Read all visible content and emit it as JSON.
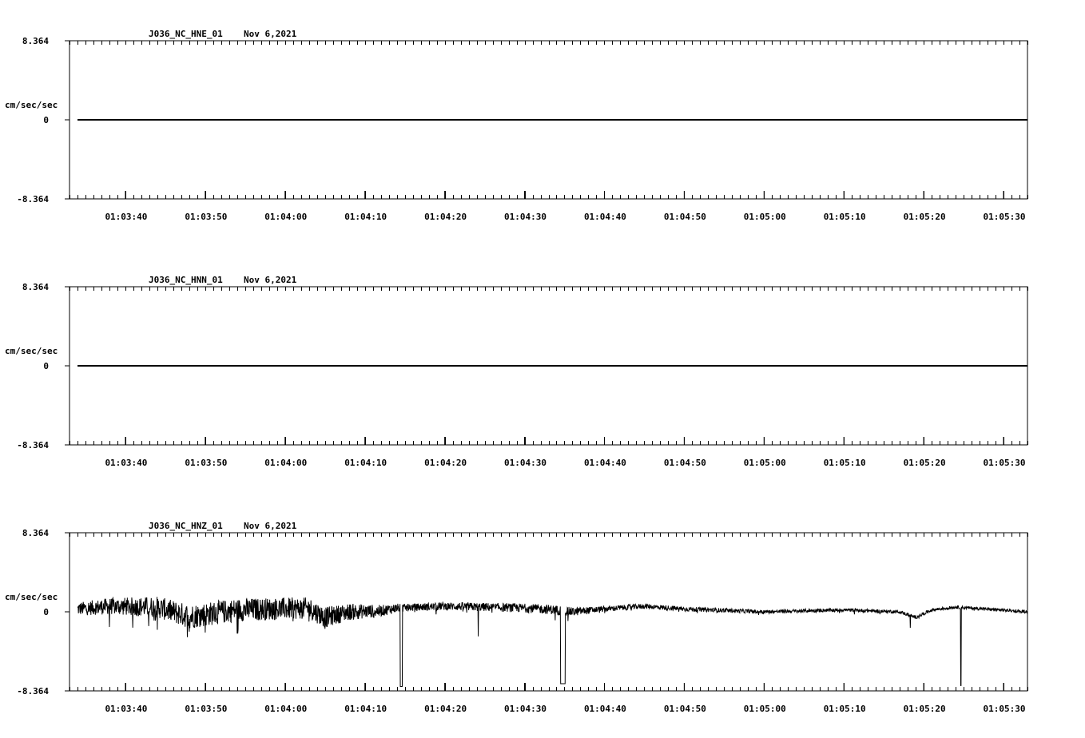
{
  "chart_data": [
    {
      "type": "line",
      "title": "J036_NC_HNE_01",
      "date": "Nov 6,2021",
      "ylabel": "cm/sec/sec",
      "ylim": [
        -8.364,
        8.364
      ],
      "y_tick_labels": [
        "8.364",
        "0",
        "-8.364"
      ],
      "x_tick_labels": [
        "01:03:40",
        "01:03:50",
        "01:04:00",
        "01:04:10",
        "01:04:20",
        "01:04:30",
        "01:04:40",
        "01:04:50",
        "01:05:00",
        "01:05:10",
        "01:05:20",
        "01:05:30"
      ],
      "xlim": [
        "01:03:33",
        "01:05:33"
      ],
      "grid": false,
      "series": [
        {
          "values_description_free": true,
          "segments": [
            {
              "x": [
                "01:03:34",
                "01:05:33"
              ],
              "y": [
                0,
                0
              ]
            }
          ]
        }
      ]
    },
    {
      "type": "line",
      "title": "J036_NC_HNN_01",
      "date": "Nov 6,2021",
      "ylabel": "cm/sec/sec",
      "ylim": [
        -8.364,
        8.364
      ],
      "y_tick_labels": [
        "8.364",
        "0",
        "-8.364"
      ],
      "x_tick_labels": [
        "01:03:40",
        "01:03:50",
        "01:04:00",
        "01:04:10",
        "01:04:20",
        "01:04:30",
        "01:04:40",
        "01:04:50",
        "01:05:00",
        "01:05:10",
        "01:05:20",
        "01:05:30"
      ],
      "xlim": [
        "01:03:33",
        "01:05:33"
      ],
      "grid": false,
      "series": [
        {
          "segments": [
            {
              "x": [
                "01:03:34",
                "01:05:33"
              ],
              "y": [
                0,
                0
              ]
            }
          ]
        }
      ]
    },
    {
      "type": "line",
      "title": "J036_NC_HNZ_01",
      "date": "Nov 6,2021",
      "ylabel": "cm/sec/sec",
      "ylim": [
        -8.364,
        8.364
      ],
      "y_tick_labels": [
        "8.364",
        "0",
        "-8.364"
      ],
      "x_tick_labels": [
        "01:03:40",
        "01:03:50",
        "01:04:00",
        "01:04:10",
        "01:04:20",
        "01:04:30",
        "01:04:40",
        "01:04:50",
        "01:05:00",
        "01:05:10",
        "01:05:20",
        "01:05:30"
      ],
      "xlim": [
        "01:03:33",
        "01:05:33"
      ],
      "grid": false,
      "noisy": true,
      "baseline": [
        [
          "01:03:34",
          0.3
        ],
        [
          "01:03:38",
          0.6
        ],
        [
          "01:03:44",
          0.5
        ],
        [
          "01:03:48",
          -0.5
        ],
        [
          "01:03:54",
          0.2
        ],
        [
          "01:03:58",
          0.3
        ],
        [
          "01:04:03",
          0.4
        ],
        [
          "01:04:05",
          -0.6
        ],
        [
          "01:04:08",
          0.0
        ],
        [
          "01:04:12",
          0.1
        ],
        [
          "01:04:14",
          0.4
        ],
        [
          "01:04:20",
          0.6
        ],
        [
          "01:04:30",
          0.4
        ],
        [
          "01:04:34",
          0.2
        ],
        [
          "01:04:36",
          0.0
        ],
        [
          "01:04:40",
          0.3
        ],
        [
          "01:04:45",
          0.6
        ],
        [
          "01:04:50",
          0.3
        ],
        [
          "01:05:00",
          0.0
        ],
        [
          "01:05:10",
          0.2
        ],
        [
          "01:05:17",
          0.0
        ],
        [
          "01:05:19",
          -0.6
        ],
        [
          "01:05:21",
          0.2
        ],
        [
          "01:05:24",
          0.5
        ],
        [
          "01:05:26",
          0.4
        ],
        [
          "01:05:33",
          0.0
        ]
      ],
      "noise_amplitude": [
        [
          "01:03:34",
          0.7
        ],
        [
          "01:03:48",
          1.3
        ],
        [
          "01:04:05",
          1.1
        ],
        [
          "01:04:15",
          0.4
        ],
        [
          "01:04:35",
          0.5
        ],
        [
          "01:04:40",
          0.3
        ],
        [
          "01:05:00",
          0.2
        ],
        [
          "01:05:33",
          0.15
        ]
      ],
      "spikes": [
        {
          "t": "01:03:38",
          "y": -1.6
        },
        {
          "t": "01:03:44",
          "y": -1.9
        },
        {
          "t": "01:03:48",
          "y": -2.1
        },
        {
          "t": "01:03:50",
          "y": -2.2
        },
        {
          "t": "01:03:54",
          "y": -2.3
        },
        {
          "t": "01:04:05",
          "y": -1.8
        },
        {
          "t": "01:04:24.2",
          "y": -2.6
        },
        {
          "t": "01:05:18.3",
          "y": -1.7
        }
      ],
      "dropouts": [
        {
          "start": "01:04:14.4",
          "end": "01:04:14.7",
          "y": -7.9
        },
        {
          "start": "01:04:34.5",
          "end": "01:04:35.1",
          "y": -7.6
        },
        {
          "start": "01:05:24.6",
          "end": "01:05:24.7",
          "y": -7.8
        }
      ]
    }
  ]
}
